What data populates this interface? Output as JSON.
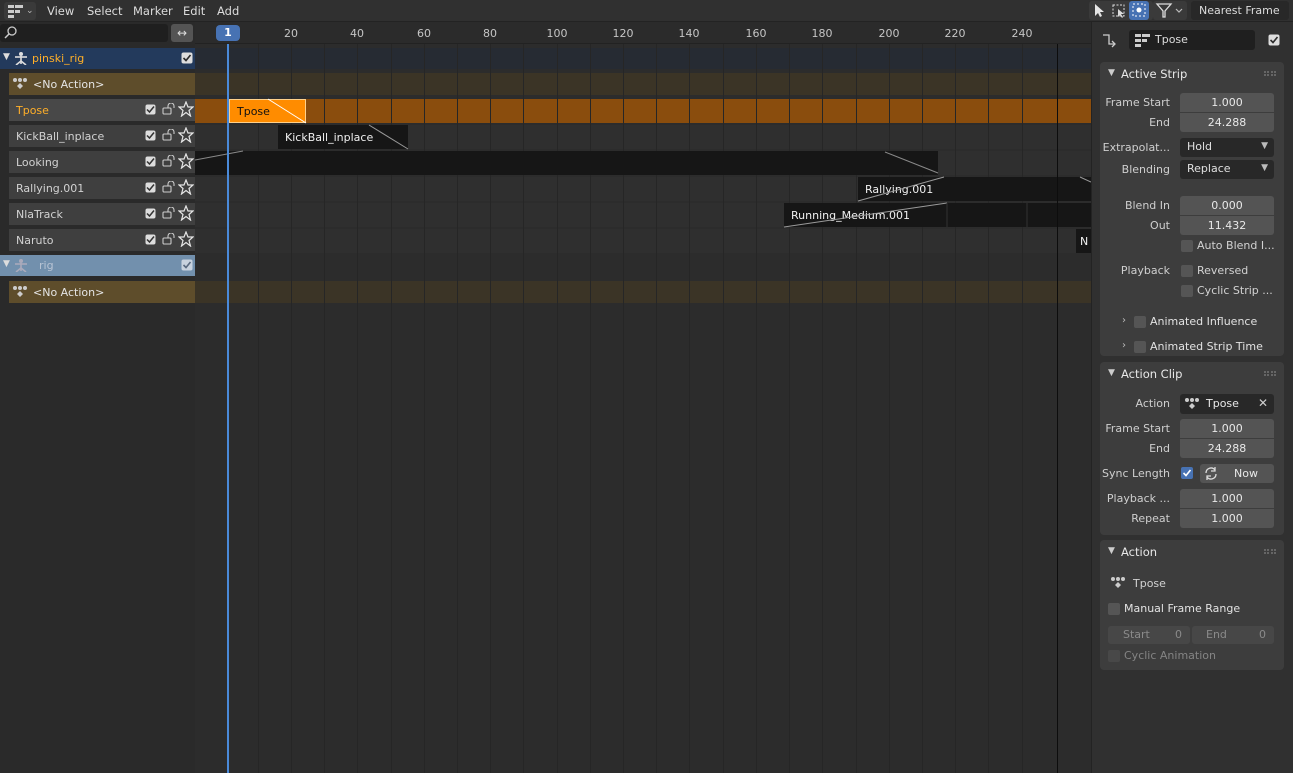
{
  "header": {
    "editor_type_icon": "nla-editor-icon",
    "menus": [
      "View",
      "Select",
      "Marker",
      "Edit",
      "Add"
    ],
    "snap_mode": "Nearest Frame"
  },
  "channels": {
    "objects": [
      {
        "name": "pinski_rig",
        "action_slot": "<No Action>"
      },
      {
        "name": "rig",
        "action_slot": "<No Action>"
      }
    ],
    "tracks": [
      "Tpose",
      "KickBall_inplace",
      "Looking",
      "Rallying.001",
      "NlaTrack",
      "Naruto"
    ],
    "active_track": "Tpose"
  },
  "timeline": {
    "current_frame": "1",
    "ticks": [
      "20",
      "40",
      "60",
      "80",
      "100",
      "120",
      "140",
      "160",
      "180",
      "200",
      "220",
      "240"
    ],
    "strips": [
      "Tpose",
      "KickBall_inplace",
      "Rallying.001",
      "Running_Medium.001",
      "N"
    ]
  },
  "sidebar": {
    "strip_name": "Tpose",
    "active_strip": {
      "title": "Active Strip",
      "frame_start_label": "Frame Start",
      "frame_start": "1.000",
      "end_label": "End",
      "end": "24.288",
      "extrapolation_label": "Extrapolat...",
      "extrapolation": "Hold",
      "blending_label": "Blending",
      "blending": "Replace",
      "blend_in_label": "Blend In",
      "blend_in": "0.000",
      "out_label": "Out",
      "blend_out": "11.432",
      "auto_blend": "Auto Blend I...",
      "playback_label": "Playback",
      "reversed": "Reversed",
      "cyclic_strip": "Cyclic Strip ...",
      "animated_influence": "Animated Influence",
      "animated_strip_time": "Animated Strip Time"
    },
    "action_clip": {
      "title": "Action Clip",
      "action_label": "Action",
      "action": "Tpose",
      "frame_start_label": "Frame Start",
      "frame_start": "1.000",
      "end_label": "End",
      "end": "24.288",
      "sync_length_label": "Sync Length",
      "sync_now": "Now",
      "playback_label": "Playback ...",
      "playback_scale": "1.000",
      "repeat_label": "Repeat",
      "repeat": "1.000"
    },
    "action": {
      "title": "Action",
      "name": "Tpose",
      "manual_frame_range": "Manual Frame Range",
      "start_label": "Start",
      "start": "0",
      "end_label": "End",
      "end": "0",
      "cyclic_animation": "Cyclic Animation"
    }
  },
  "colors": {
    "accent": "#4772b3",
    "active_strip": "#ff8c00",
    "active_track_text": "#ffaf29",
    "action_slot": "#5e4d2b"
  }
}
